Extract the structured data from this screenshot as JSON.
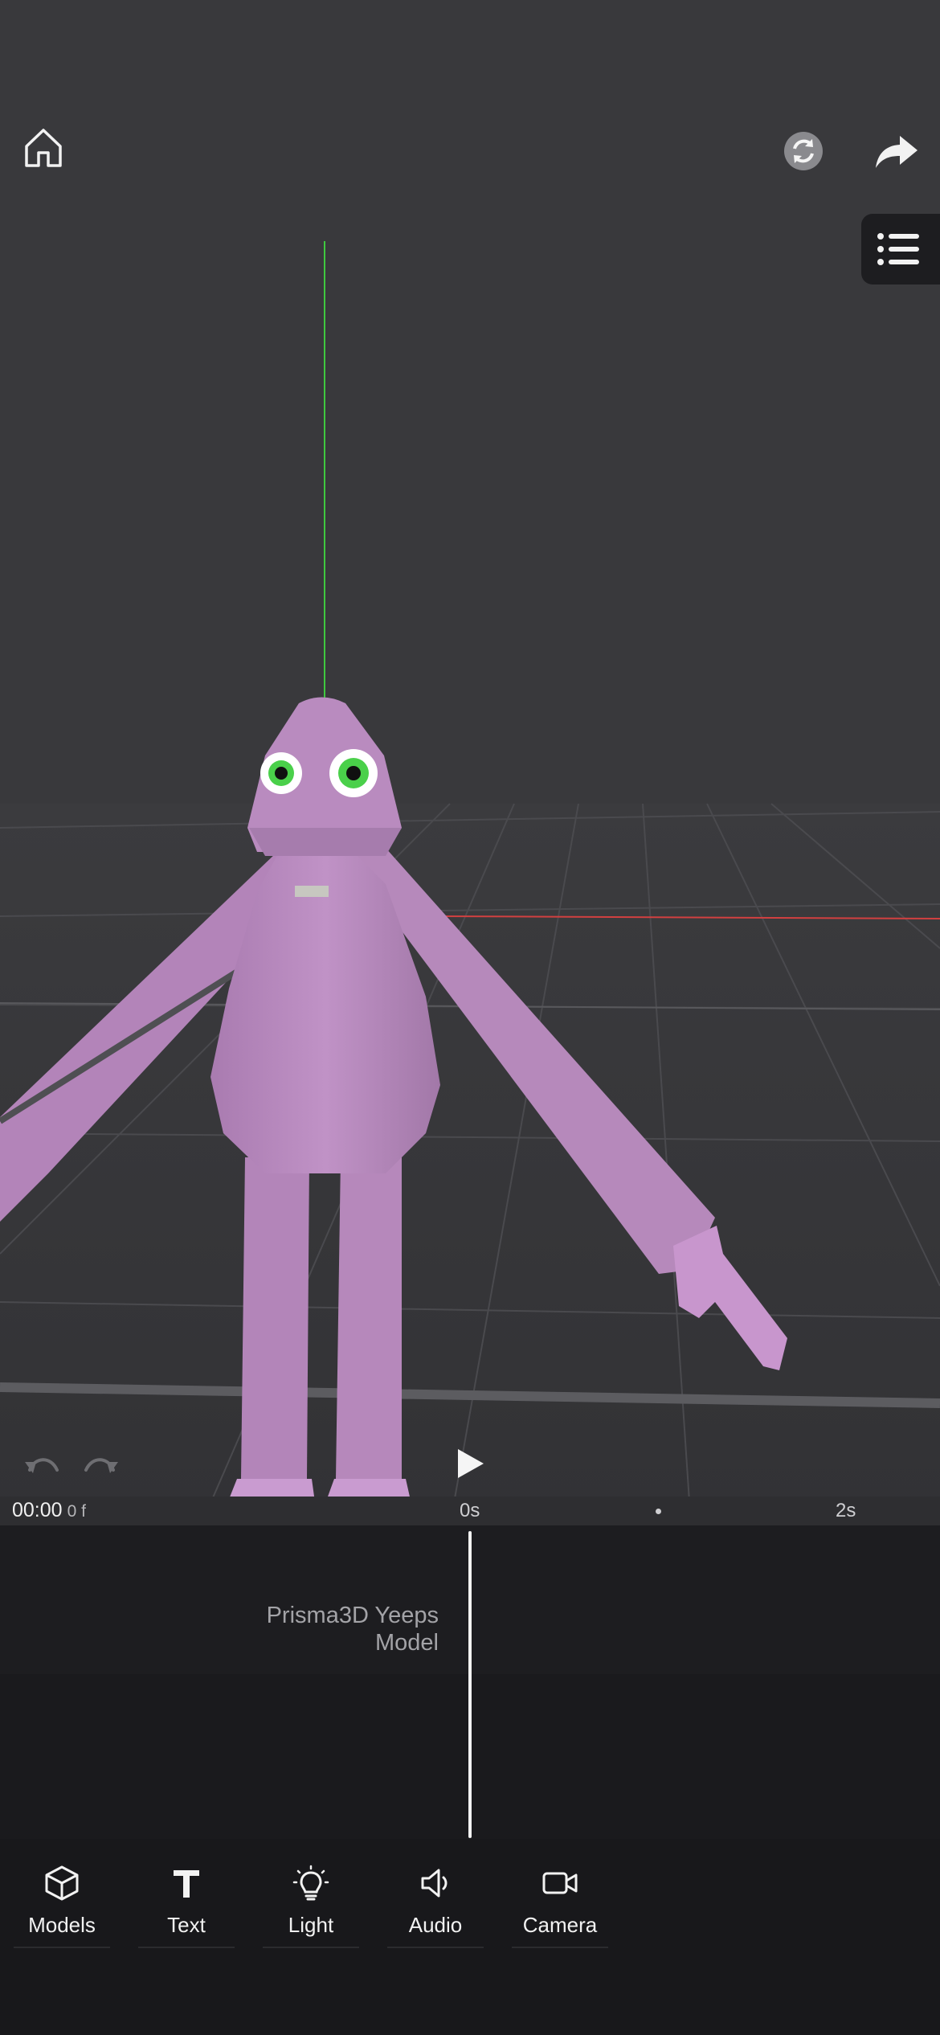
{
  "toolbar": {
    "home_icon": "home-icon",
    "sync_icon": "sync-icon",
    "share_icon": "share-arrow-icon",
    "layers_icon": "list-icon"
  },
  "playback": {
    "current_time": "00:00",
    "current_frame": "0 f",
    "ticks": [
      "0s",
      "2s"
    ],
    "play_icon": "play-icon",
    "undo_icon": "undo-icon",
    "redo_icon": "redo-icon"
  },
  "timeline": {
    "track_label_line1": "Prisma3D Yeeps",
    "track_label_line2": "Model"
  },
  "nav": {
    "items": [
      {
        "label": "Models",
        "icon": "cube-icon"
      },
      {
        "label": "Text",
        "icon": "text-icon"
      },
      {
        "label": "Light",
        "icon": "lightbulb-icon"
      },
      {
        "label": "Audio",
        "icon": "speaker-icon"
      },
      {
        "label": "Camera",
        "icon": "video-camera-icon"
      }
    ]
  },
  "colors": {
    "viewport_bg": "#39393c",
    "panel_bg": "#18181b",
    "model": "#b98bbf",
    "axis_y": "#3fc93f",
    "axis_x": "#d24040"
  }
}
